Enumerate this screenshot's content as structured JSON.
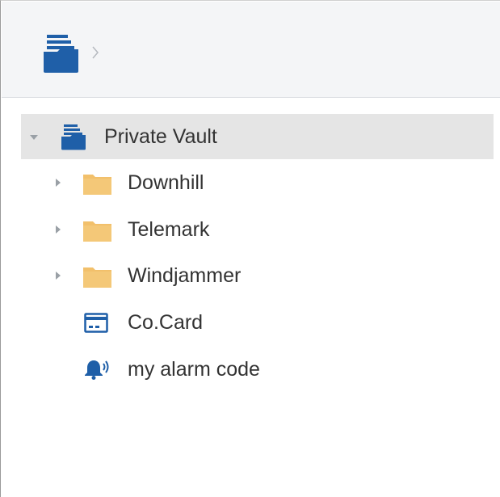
{
  "breadcrumb": {
    "root_icon": "vault-stack-icon",
    "separator_icon": "chevron-right-icon"
  },
  "tree": {
    "root": {
      "label": "Private Vault",
      "icon": "vault-stack-icon",
      "expanded": true,
      "selected": true
    },
    "children": [
      {
        "label": "Downhill",
        "icon": "folder-icon",
        "expandable": true
      },
      {
        "label": "Telemark",
        "icon": "folder-icon",
        "expandable": true
      },
      {
        "label": "Windjammer",
        "icon": "folder-icon",
        "expandable": true
      },
      {
        "label": "Co.Card",
        "icon": "credit-card-icon",
        "expandable": false
      },
      {
        "label": "my alarm code",
        "icon": "alarm-bell-icon",
        "expandable": false
      }
    ]
  },
  "colors": {
    "vault_blue": "#1f5fa8",
    "folder_yellow": "#f2c06b",
    "selection_gray": "#e5e5e5",
    "breadcrumb_bg": "#f4f5f7"
  }
}
